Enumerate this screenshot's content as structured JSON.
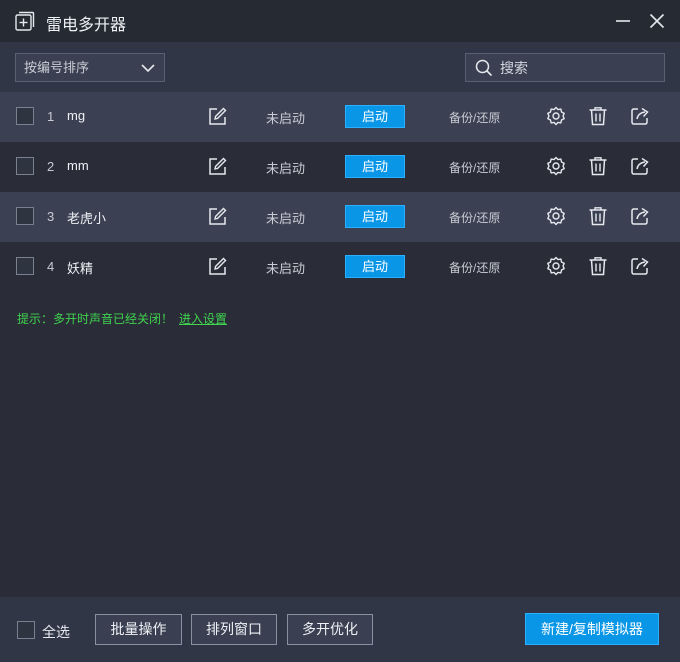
{
  "window": {
    "title": "雷电多开器"
  },
  "toolbar": {
    "sort_value": "按编号排序",
    "search_placeholder": "搜索"
  },
  "rows": [
    {
      "index": "1",
      "name": "mg",
      "status": "未启动",
      "start_label": "启动",
      "backup_label": "备份/还原"
    },
    {
      "index": "2",
      "name": "mm",
      "status": "未启动",
      "start_label": "启动",
      "backup_label": "备份/还原"
    },
    {
      "index": "3",
      "name": "老虎小",
      "status": "未启动",
      "start_label": "启动",
      "backup_label": "备份/还原"
    },
    {
      "index": "4",
      "name": "妖精",
      "status": "未启动",
      "start_label": "启动",
      "backup_label": "备份/还原"
    }
  ],
  "hint": {
    "text": "提示：多开时声音已经关闭！",
    "link": "进入设置"
  },
  "footer": {
    "select_all": "全选",
    "batch": "批量操作",
    "arrange": "排列窗口",
    "optimize": "多开优化",
    "new_copy": "新建/复制模拟器"
  },
  "colors": {
    "accent": "#0a96e6",
    "hint_green": "#3fd34e",
    "background": "#2a2d38"
  }
}
